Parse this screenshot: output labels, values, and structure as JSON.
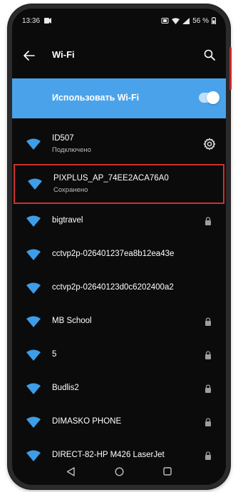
{
  "status_bar": {
    "time": "13:36",
    "battery": "56 %"
  },
  "app_bar": {
    "title": "Wi-Fi"
  },
  "wifi_toggle": {
    "label": "Использовать Wi-Fi",
    "enabled": true
  },
  "networks": [
    {
      "name": "ID507",
      "status": "Подключено",
      "icon": "gear-icon"
    },
    {
      "name": "PIXPLUS_AP_74EE2ACA76A0",
      "status": "Сохранено",
      "highlighted": true
    },
    {
      "name": "bigtravel",
      "locked": true
    },
    {
      "name": "cctvp2p-026401237ea8b12ea43e",
      "locked": false
    },
    {
      "name": "cctvp2p-02640123d0c6202400a2",
      "locked": false
    },
    {
      "name": "MB School",
      "locked": true
    },
    {
      "name": "5",
      "locked": true
    },
    {
      "name": "Budlis2",
      "locked": true
    },
    {
      "name": "DIMASKO PHONE",
      "locked": true
    },
    {
      "name": "DIRECT-82-HP M426 LaserJet",
      "locked": true
    }
  ],
  "colors": {
    "accent": "#4aa3ea",
    "highlight_border": "#d32f2f",
    "background": "#0b0b0b"
  }
}
